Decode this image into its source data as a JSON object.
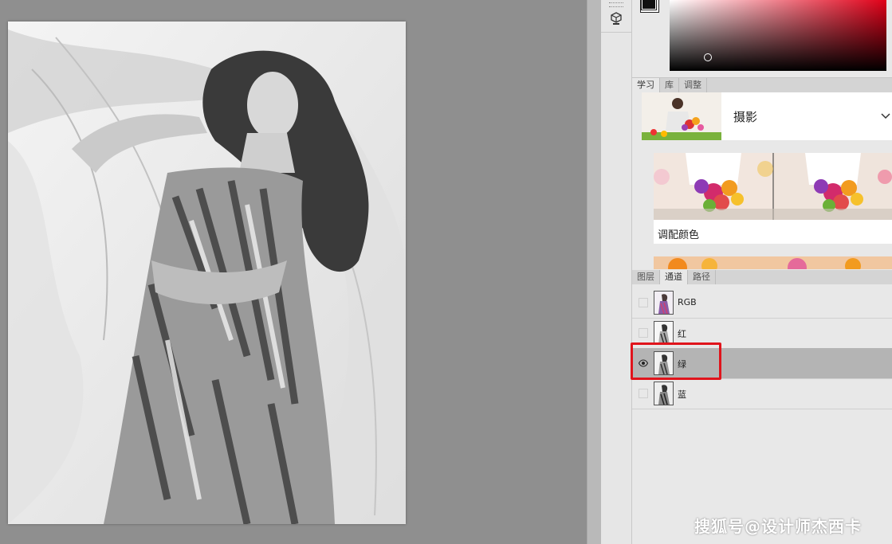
{
  "canvas": {
    "document": "grayscale-fashion-photo"
  },
  "color_panel": {
    "hue_color": "#e00018"
  },
  "learn_panel": {
    "tabs": [
      "学习",
      "库",
      "调整"
    ],
    "active_tab": 0,
    "section_title": "摄影",
    "tutorial_card_label": "调配颜色"
  },
  "channels_panel": {
    "tabs": [
      "图层",
      "通道",
      "路径"
    ],
    "active_tab": 1,
    "channels": [
      {
        "name": "RGB",
        "visible": false
      },
      {
        "name": "红",
        "visible": false
      },
      {
        "name": "绿",
        "visible": true,
        "selected": true
      },
      {
        "name": "蓝",
        "visible": false
      }
    ]
  },
  "watermark": "搜狐号@设计师杰西卡",
  "colors": {
    "highlight": "#e0141c",
    "selected_row": "#b4b4b4"
  }
}
